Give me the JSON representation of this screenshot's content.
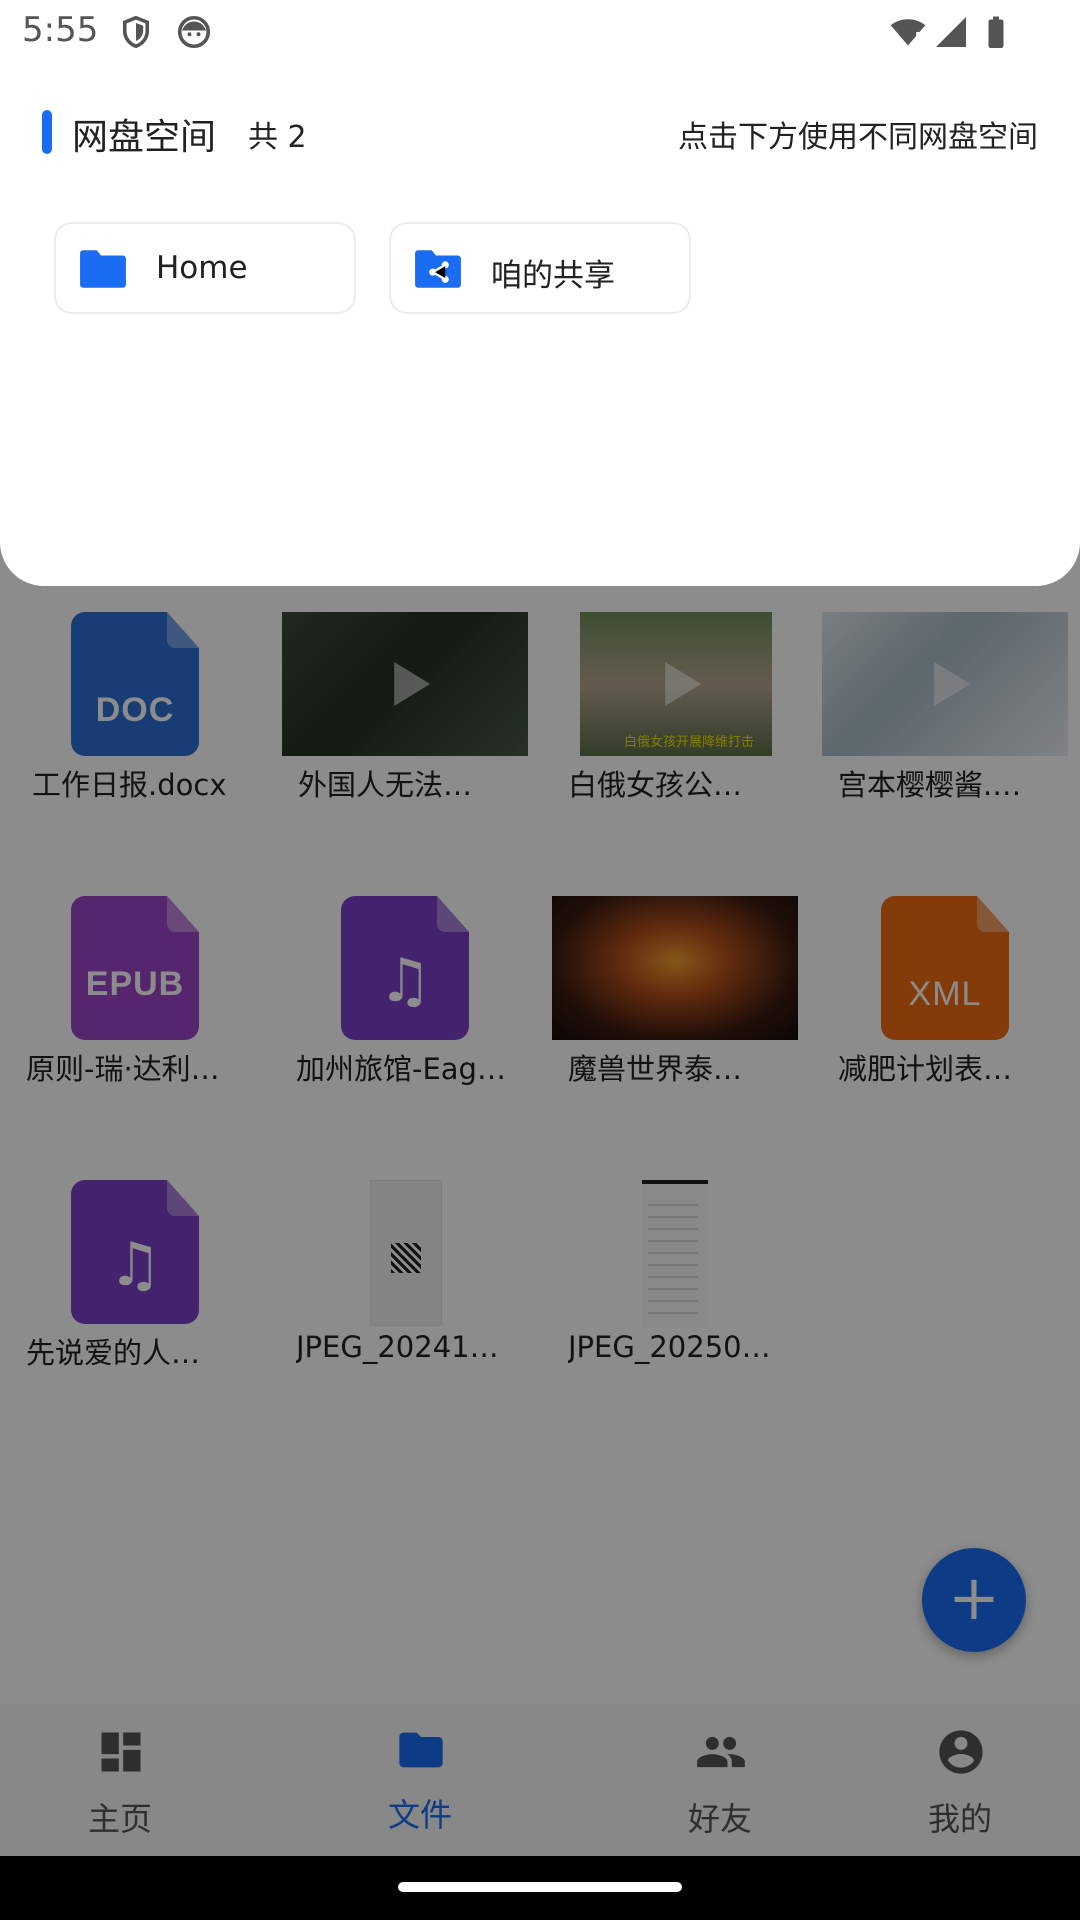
{
  "status_bar": {
    "time": "5:55"
  },
  "sheet": {
    "title": "网盘空间",
    "count": "共 2",
    "hint": "点击下方使用不同网盘空间",
    "spaces": [
      {
        "label": "Home",
        "icon": "folder-icon"
      },
      {
        "label": "咱的共享",
        "icon": "shared-folder-icon"
      }
    ]
  },
  "files": [
    {
      "name": "工作日报.docx",
      "type": "doc",
      "badge": "DOC"
    },
    {
      "name": "外国人无法…",
      "type": "video"
    },
    {
      "name": "白俄女孩公…",
      "type": "video",
      "caption": "白俄女孩开展降维打击"
    },
    {
      "name": "宫本樱樱酱.…",
      "type": "video"
    },
    {
      "name": "原则-瑞·达利…",
      "type": "epub",
      "badge": "EPUB"
    },
    {
      "name": "加州旅馆-Eag…",
      "type": "audio"
    },
    {
      "name": "魔兽世界泰…",
      "type": "image"
    },
    {
      "name": "减肥计划表…",
      "type": "xml",
      "badge": "XML"
    },
    {
      "name": "先说爱的人…",
      "type": "audio"
    },
    {
      "name": "JPEG_20241…",
      "type": "image"
    },
    {
      "name": "JPEG_20250…",
      "type": "image"
    }
  ],
  "fab": {
    "label": "+"
  },
  "bottom_nav": [
    {
      "label": "主页",
      "icon": "dashboard-icon",
      "active": false
    },
    {
      "label": "文件",
      "icon": "folder-icon",
      "active": true
    },
    {
      "label": "好友",
      "icon": "people-icon",
      "active": false
    },
    {
      "label": "我的",
      "icon": "account-icon",
      "active": false
    }
  ],
  "colors": {
    "accent": "#1a6cf2",
    "doc": "#2c6fd6",
    "epub": "#9b45c9",
    "audio": "#7a3fc8",
    "xml": "#ee6c12"
  }
}
